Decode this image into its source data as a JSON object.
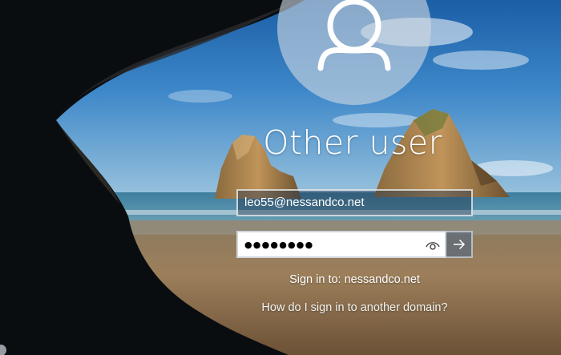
{
  "login": {
    "title": "Other user",
    "email_value": "leo55@nessandco.net",
    "password_mask": "●●●●●●●●",
    "sign_in_to": "Sign in to: nessandco.net",
    "domain_help_link": "How do I sign in to another domain?"
  },
  "icons": {
    "avatar": "user-silhouette-icon",
    "reveal": "eye-icon",
    "submit": "arrow-right-icon"
  },
  "colors": {
    "avatar_bg": "#cdd6e0",
    "text": "#ffffff",
    "password_bg": "#ffffff",
    "submit_bg": "#5f6c7a"
  }
}
